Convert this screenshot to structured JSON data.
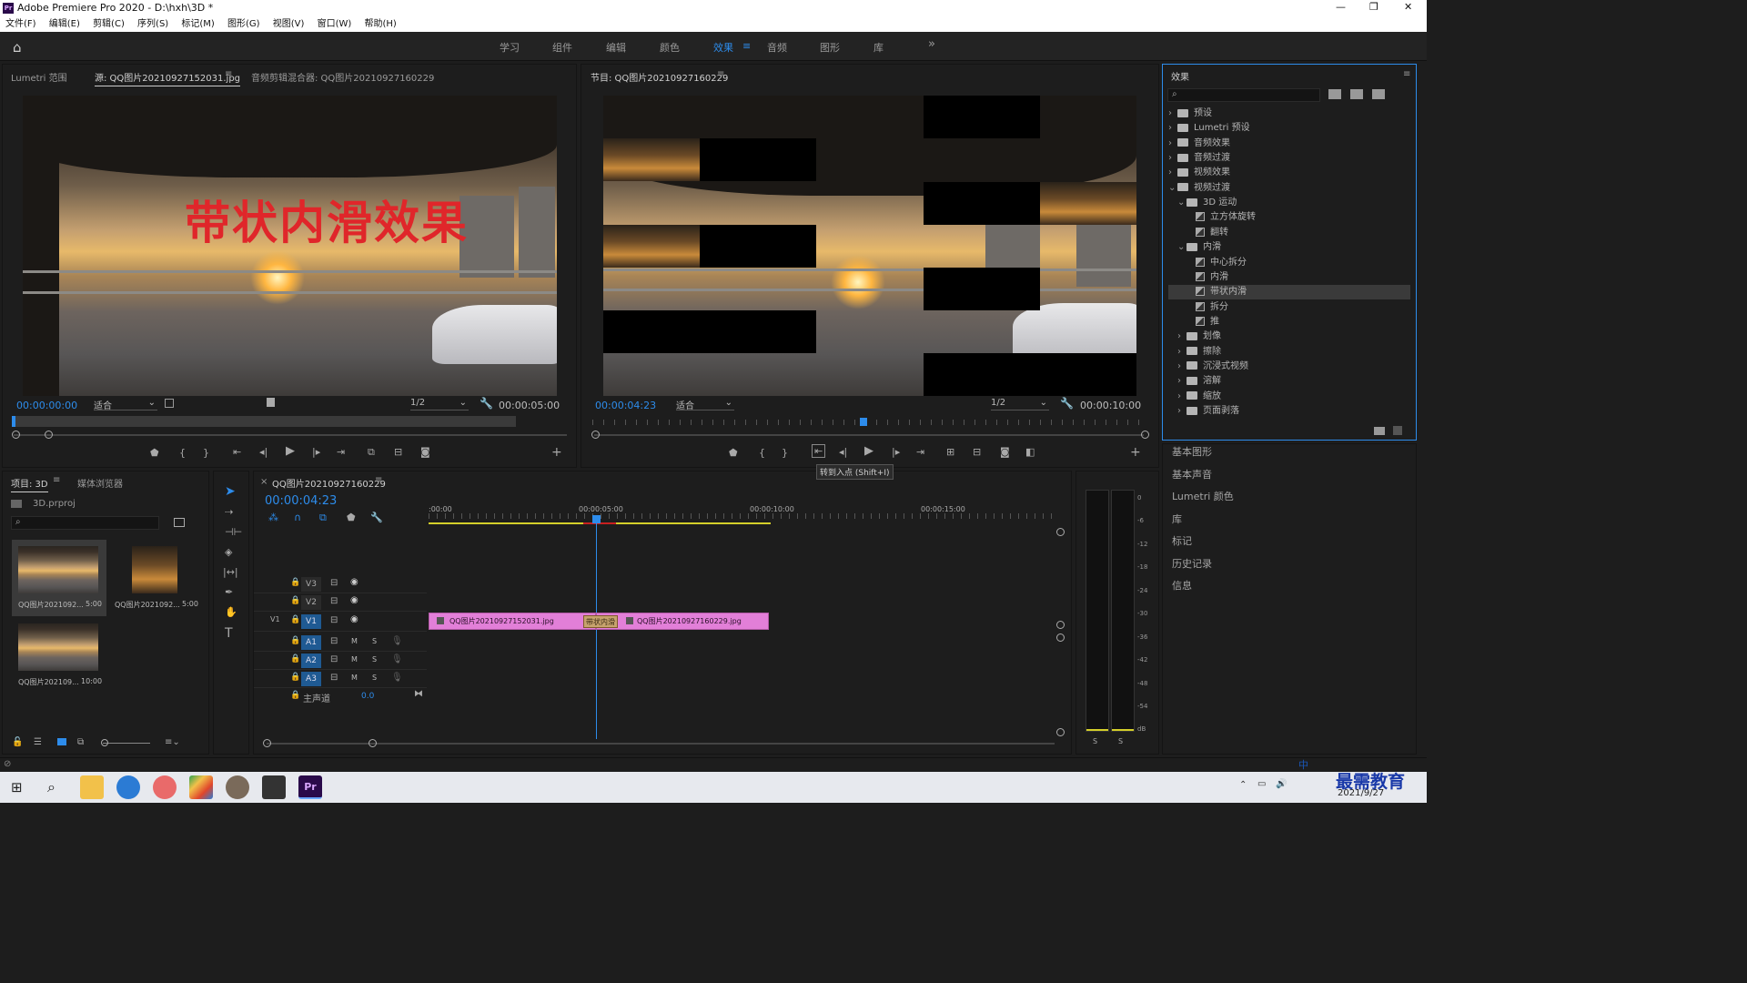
{
  "app": {
    "title": "Adobe Premiere Pro 2020 - D:\\hxh\\3D *",
    "window_controls": [
      "—",
      "❐",
      "✕"
    ]
  },
  "menu": [
    "文件(F)",
    "编辑(E)",
    "剪辑(C)",
    "序列(S)",
    "标记(M)",
    "图形(G)",
    "视图(V)",
    "窗口(W)",
    "帮助(H)"
  ],
  "workspaces": {
    "items": [
      "学习",
      "组件",
      "编辑",
      "颜色",
      "效果",
      "音频",
      "图形",
      "库"
    ],
    "active": "效果",
    "more": "»"
  },
  "source_panel": {
    "tabs": [
      "Lumetri 范围",
      "源: QQ图片20210927152031.jpg",
      "音频剪辑混合器: QQ图片20210927160229"
    ],
    "overlay_text": "带状内滑效果",
    "timecode_in": "00:00:00:00",
    "fit": "适合",
    "resolution": "1/2",
    "duration": "00:00:05:00"
  },
  "program_panel": {
    "tab": "节目: QQ图片20210927160229",
    "timecode": "00:00:04:23",
    "fit": "适合",
    "resolution": "1/2",
    "duration": "00:00:10:00",
    "tooltip": "转到入点 (Shift+I)"
  },
  "project_panel": {
    "tabs": [
      "项目: 3D",
      "媒体浏览器"
    ],
    "project_file": "3D.prproj",
    "items": [
      {
        "name": "QQ图片2021092...",
        "duration": "5:00"
      },
      {
        "name": "QQ图片2021092...",
        "duration": "5:00"
      },
      {
        "name": "QQ图片202109...",
        "duration": "10:00"
      }
    ]
  },
  "timeline": {
    "tab": "QQ图片20210927160229",
    "timecode": "00:00:04:23",
    "ruler": [
      ":00:00",
      "00:00:05:00",
      "00:00:10:00",
      "00:00:15:00"
    ],
    "video_tracks": [
      "V3",
      "V2",
      "V1"
    ],
    "audio_tracks": [
      "A1",
      "A2",
      "A3"
    ],
    "master": {
      "label": "主声道",
      "value": "0.0"
    },
    "v1_source": "V1",
    "clip1": "QQ图片20210927152031.jpg",
    "clip2": "QQ图片20210927160229.jpg",
    "transition": "带状内滑",
    "mute": "M",
    "solo": "S"
  },
  "audio_meter": {
    "scale": [
      "0",
      "-6",
      "-12",
      "-18",
      "-24",
      "-30",
      "-36",
      "-42",
      "-48",
      "-54",
      "dB"
    ],
    "solo": [
      "S",
      "S"
    ]
  },
  "effects_panel": {
    "title": "效果",
    "tree": [
      {
        "label": "预设",
        "type": "folder",
        "level": 0
      },
      {
        "label": "Lumetri 预设",
        "type": "folder",
        "level": 0
      },
      {
        "label": "音频效果",
        "type": "folder",
        "level": 0
      },
      {
        "label": "音频过渡",
        "type": "folder",
        "level": 0
      },
      {
        "label": "视频效果",
        "type": "folder",
        "level": 0
      },
      {
        "label": "视频过渡",
        "type": "folder",
        "level": 0,
        "open": true
      },
      {
        "label": "3D 运动",
        "type": "folder",
        "level": 1,
        "open": true
      },
      {
        "label": "立方体旋转",
        "type": "fx",
        "level": 2
      },
      {
        "label": "翻转",
        "type": "fx",
        "level": 2
      },
      {
        "label": "内滑",
        "type": "folder",
        "level": 1,
        "open": true
      },
      {
        "label": "中心拆分",
        "type": "fx",
        "level": 2
      },
      {
        "label": "内滑",
        "type": "fx",
        "level": 2
      },
      {
        "label": "带状内滑",
        "type": "fx",
        "level": 2,
        "selected": true
      },
      {
        "label": "拆分",
        "type": "fx",
        "level": 2
      },
      {
        "label": "推",
        "type": "fx",
        "level": 2
      },
      {
        "label": "划像",
        "type": "folder",
        "level": 1
      },
      {
        "label": "擦除",
        "type": "folder",
        "level": 1
      },
      {
        "label": "沉浸式视频",
        "type": "folder",
        "level": 1
      },
      {
        "label": "溶解",
        "type": "folder",
        "level": 1
      },
      {
        "label": "缩放",
        "type": "folder",
        "level": 1
      },
      {
        "label": "页面剥落",
        "type": "folder",
        "level": 1
      }
    ]
  },
  "right_panels": [
    "基本图形",
    "基本声音",
    "Lumetri 颜色",
    "库",
    "标记",
    "历史记录",
    "信息"
  ],
  "taskbar": {
    "date": "2021/9/27",
    "ime": "中",
    "watermark": "最需教育"
  }
}
